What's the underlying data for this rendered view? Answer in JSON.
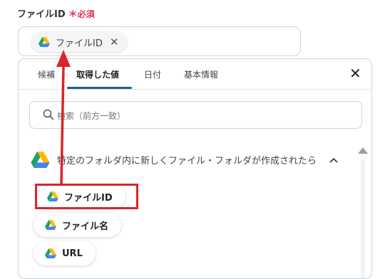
{
  "field": {
    "label": "ファイルID",
    "required_mark": "＊",
    "required_text": "必須",
    "selected_value": "ファイルID",
    "remove_symbol": "✕"
  },
  "picker": {
    "tabs": [
      {
        "label": "候補",
        "active": false
      },
      {
        "label": "取得した値",
        "active": true
      },
      {
        "label": "日付",
        "active": false
      },
      {
        "label": "基本情報",
        "active": false
      }
    ],
    "close_symbol": "✕",
    "search_placeholder": "検索（前方一致）",
    "trigger_label": "特定のフォルダ内に新しくファイル・フォルダが作成されたら",
    "items": [
      {
        "label": "ファイルID",
        "icon": "google-drive-icon"
      },
      {
        "label": "ファイル名",
        "icon": "google-drive-icon"
      },
      {
        "label": "URL",
        "icon": "google-drive-icon"
      }
    ]
  },
  "colors": {
    "required": "#e0335a",
    "tab_underline": "#1f5f8a",
    "annotation": "#d9252a",
    "drive_green": "#1ea362",
    "drive_yellow": "#ffba00",
    "drive_blue": "#4285f4"
  }
}
